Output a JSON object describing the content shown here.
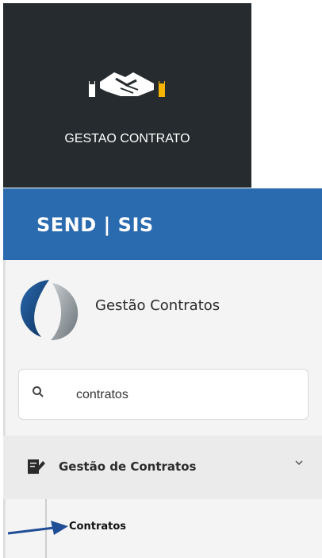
{
  "tile": {
    "label": "GESTAO CONTRATO",
    "icon": "handshake-icon"
  },
  "header": {
    "brand": "SEND | SIS"
  },
  "sidebar": {
    "app_title": "Gestão Contratos",
    "search": {
      "value": "contratos",
      "icon": "search-icon"
    },
    "menu": {
      "group_label": "Gestão de Contratos",
      "group_icon": "contract-sign-icon",
      "items": [
        {
          "label": "Contratos"
        }
      ]
    }
  },
  "colors": {
    "tile_bg": "#252b2e",
    "header_bg": "#2a6aae",
    "panel_bg": "#f4f4f4",
    "annotation_arrow": "#1f4e96"
  }
}
